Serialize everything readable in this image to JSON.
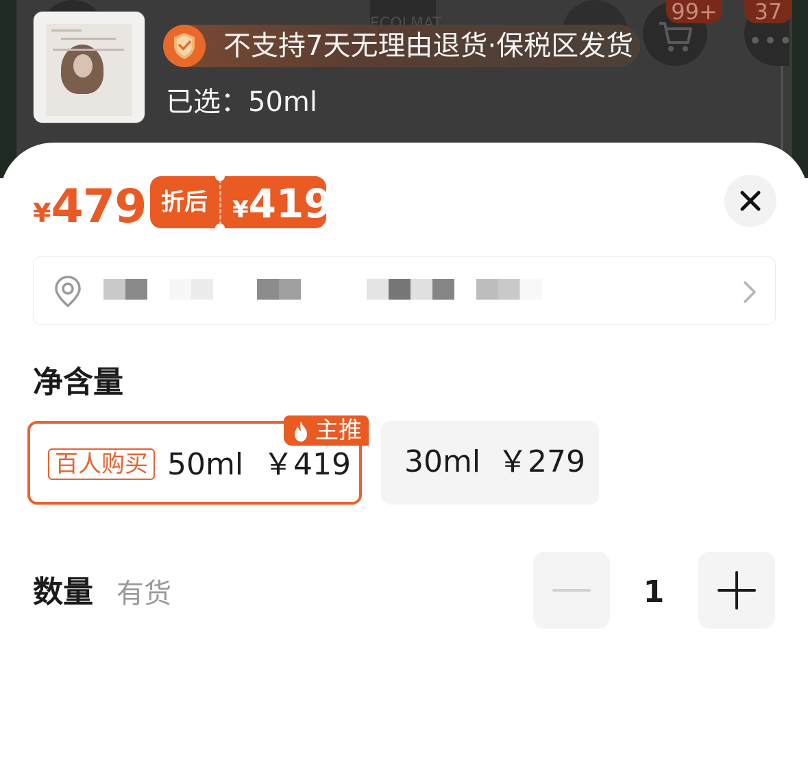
{
  "background": {
    "cart_count": "99+",
    "more_count": "37",
    "logo_text": "ECOLMAT"
  },
  "product": {
    "thumbnail_alt": "product-thumbnail",
    "thumb_brand": "ECOMAAT",
    "thumb_headline": "「性价比」方略者",
    "thumb_tags": [
      "蓬松柔顺",
      "静心平和",
      "抚顺毛糙"
    ]
  },
  "notice": {
    "text": "不支持7天无理由退货·保税区发货"
  },
  "selected": {
    "text": "已选：50ml"
  },
  "price": {
    "currency": "¥",
    "original": "479",
    "coupon_label": "折后",
    "after_discount": "419"
  },
  "address": {
    "icon": "location-pin-icon",
    "text": ""
  },
  "spec": {
    "title": "净含量",
    "options": [
      {
        "tag": "百人购买",
        "name": "50ml",
        "price": "￥419",
        "badge": "主推",
        "selected": true
      },
      {
        "name": "30ml",
        "price": "￥279",
        "selected": false
      }
    ]
  },
  "quantity": {
    "title": "数量",
    "stock": "有货",
    "value": "1"
  },
  "colors": {
    "accent": "#EA5A23",
    "selected_border": "#E9622E",
    "option_bg": "#F4F4F4"
  }
}
